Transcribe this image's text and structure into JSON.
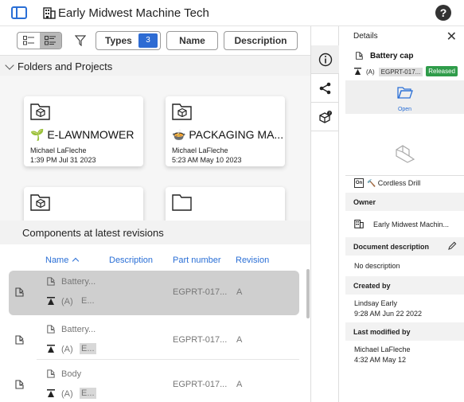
{
  "app": {
    "title": "Early Midwest Machine Tech"
  },
  "toolbar": {
    "filter_types_label": "Types",
    "filter_types_count": "3",
    "filter_name_label": "Name",
    "filter_description_label": "Description"
  },
  "folders_section": {
    "label": "Folders and Projects",
    "cards": [
      {
        "name": "🌱 E-LAWNMOWER",
        "owner": "Michael LaFleche",
        "time": "1:39 PM Jul 31 2023"
      },
      {
        "name": "🍲 PACKAGING MA...",
        "owner": "Michael LaFleche",
        "time": "5:23 AM May 10 2023"
      },
      {
        "name": "",
        "owner": "",
        "time": ""
      },
      {
        "name": "",
        "owner": "",
        "time": ""
      }
    ]
  },
  "components_section": {
    "label": "Components at latest revisions",
    "columns": {
      "name": "Name",
      "description": "Description",
      "part_number": "Part number",
      "revision": "Revision"
    },
    "rows": [
      {
        "name": "Battery...",
        "rev": "(A)",
        "rev_extra": "E...",
        "part_number": "EGPRT-017...",
        "revision": "A"
      },
      {
        "name": "Battery...",
        "rev": "(A)",
        "rev_extra": "E...",
        "part_number": "EGPRT-017...",
        "revision": "A"
      },
      {
        "name": "Body",
        "rev": "(A)",
        "rev_extra": "E...",
        "part_number": "EGPRT-017...",
        "revision": "A"
      }
    ]
  },
  "details": {
    "title": "Details",
    "item_name": "Battery cap",
    "revision": "(A)",
    "part_number": "EGPRT-017...",
    "status": "Released",
    "open_label": "Open",
    "context": "🔨 Cordless Drill",
    "owner_heading": "Owner",
    "owner_value": "Early Midwest Machin...",
    "description_heading": "Document description",
    "description_value": "No description",
    "created_heading": "Created by",
    "created_by": "Lindsay Early",
    "created_time": "9:28 AM Jun 22 2022",
    "modified_heading": "Last modified by",
    "modified_by": "Michael LaFleche",
    "modified_time": "4:32 AM May 12"
  },
  "colors": {
    "accent": "#2a6fd6",
    "badge": "#2d6bd3",
    "released": "#2f9c4a"
  }
}
